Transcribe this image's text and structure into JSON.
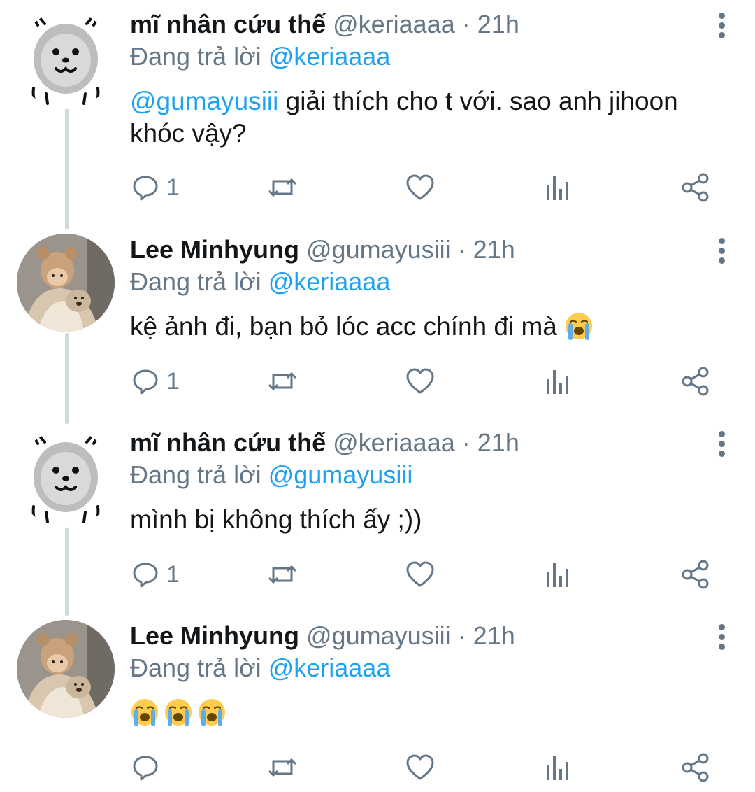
{
  "tweets": [
    {
      "name": "mĩ nhân cứu thế",
      "handle": "@keriaaaa",
      "separator": "·",
      "time": "21h",
      "replying_prefix": "Đang trả lời",
      "replying_to": "@keriaaaa",
      "mention": "@gumayusiii",
      "text": " giải thích cho t với. sao anh jihoon khóc vậy?",
      "reply_count": "1",
      "avatar": "bear-drawing"
    },
    {
      "name": "Lee Minhyung",
      "handle": "@gumayusiii",
      "separator": "·",
      "time": "21h",
      "replying_prefix": "Đang trả lời",
      "replying_to": "@keriaaaa",
      "text": "kệ ảnh đi, bạn bỏ lóc acc chính đi mà",
      "emoji": "loudly-crying-face",
      "reply_count": "1",
      "avatar": "photo-person-with-dog"
    },
    {
      "name": "mĩ nhân cứu thế",
      "handle": "@keriaaaa",
      "separator": "·",
      "time": "21h",
      "replying_prefix": "Đang trả lời",
      "replying_to": "@gumayusiii",
      "text": "mình bị không thích ấy ;))",
      "reply_count": "1",
      "avatar": "bear-drawing"
    },
    {
      "name": "Lee Minhyung",
      "handle": "@gumayusiii",
      "separator": "·",
      "time": "21h",
      "replying_prefix": "Đang trả lời",
      "replying_to": "@keriaaaa",
      "emoji_count": 3,
      "emoji": "loudly-crying-face",
      "reply_count": "",
      "avatar": "photo-person-with-dog"
    }
  ],
  "colors": {
    "text": "#14171a",
    "secondary": "#657786",
    "link": "#1da1f2",
    "thread_line": "#cfd9de"
  },
  "icons": [
    "reply-icon",
    "retweet-icon",
    "like-icon",
    "analytics-icon",
    "share-icon",
    "more-icon"
  ]
}
